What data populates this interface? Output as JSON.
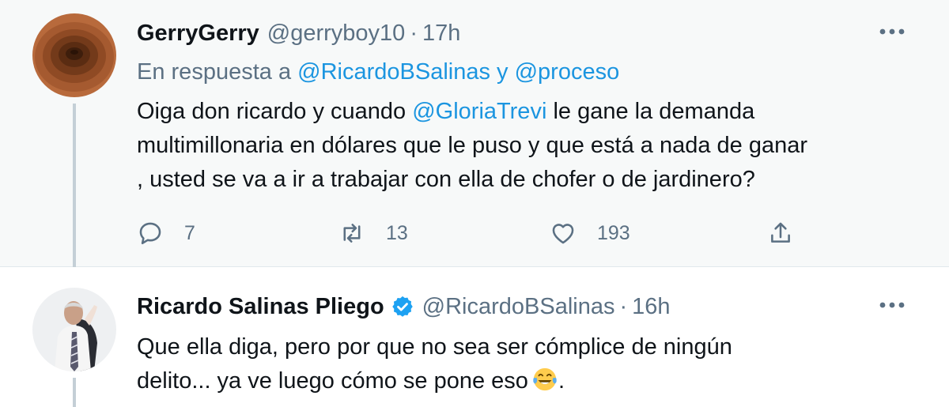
{
  "tweets": [
    {
      "name": "GerryGerry",
      "handle": "@gerryboy10",
      "separator": "·",
      "time": "17h",
      "reply_prefix": "En respuesta a",
      "reply_user_1": "@RicardoBSalinas",
      "reply_joiner": "y",
      "reply_user_2": "@proceso",
      "text_line1_before": "Oiga don ricardo y cuando",
      "text_line1_mention": "@GloriaTrevi",
      "text_line1_after": "le gane la demanda",
      "text_line2": "multimillonaria en dólares que le puso y que está a nada de ganar",
      "text_line3": ", usted se va a ir a trabajar con ella de chofer o de jardinero?",
      "replies": "7",
      "retweets": "13",
      "likes": "193",
      "avatar_icon": "brown-circles-avatar"
    },
    {
      "name": "Ricardo Salinas Pliego",
      "verified": true,
      "handle": "@RicardoBSalinas",
      "separator": "·",
      "time": "16h",
      "text_line1": "Que ella diga, pero por que no sea ser cómplice de ningún",
      "text_line2": "delito... ya ve luego cómo se pone eso",
      "text_line2_end": ".",
      "emoji": "face-with-tears-of-joy",
      "avatar_icon": "man-in-suit-avatar"
    }
  ],
  "colors": {
    "link": "#1b95e0",
    "secondary_text": "#5b7083",
    "verified": "#1da1f2",
    "reply_bg": "#f7f9f9"
  }
}
